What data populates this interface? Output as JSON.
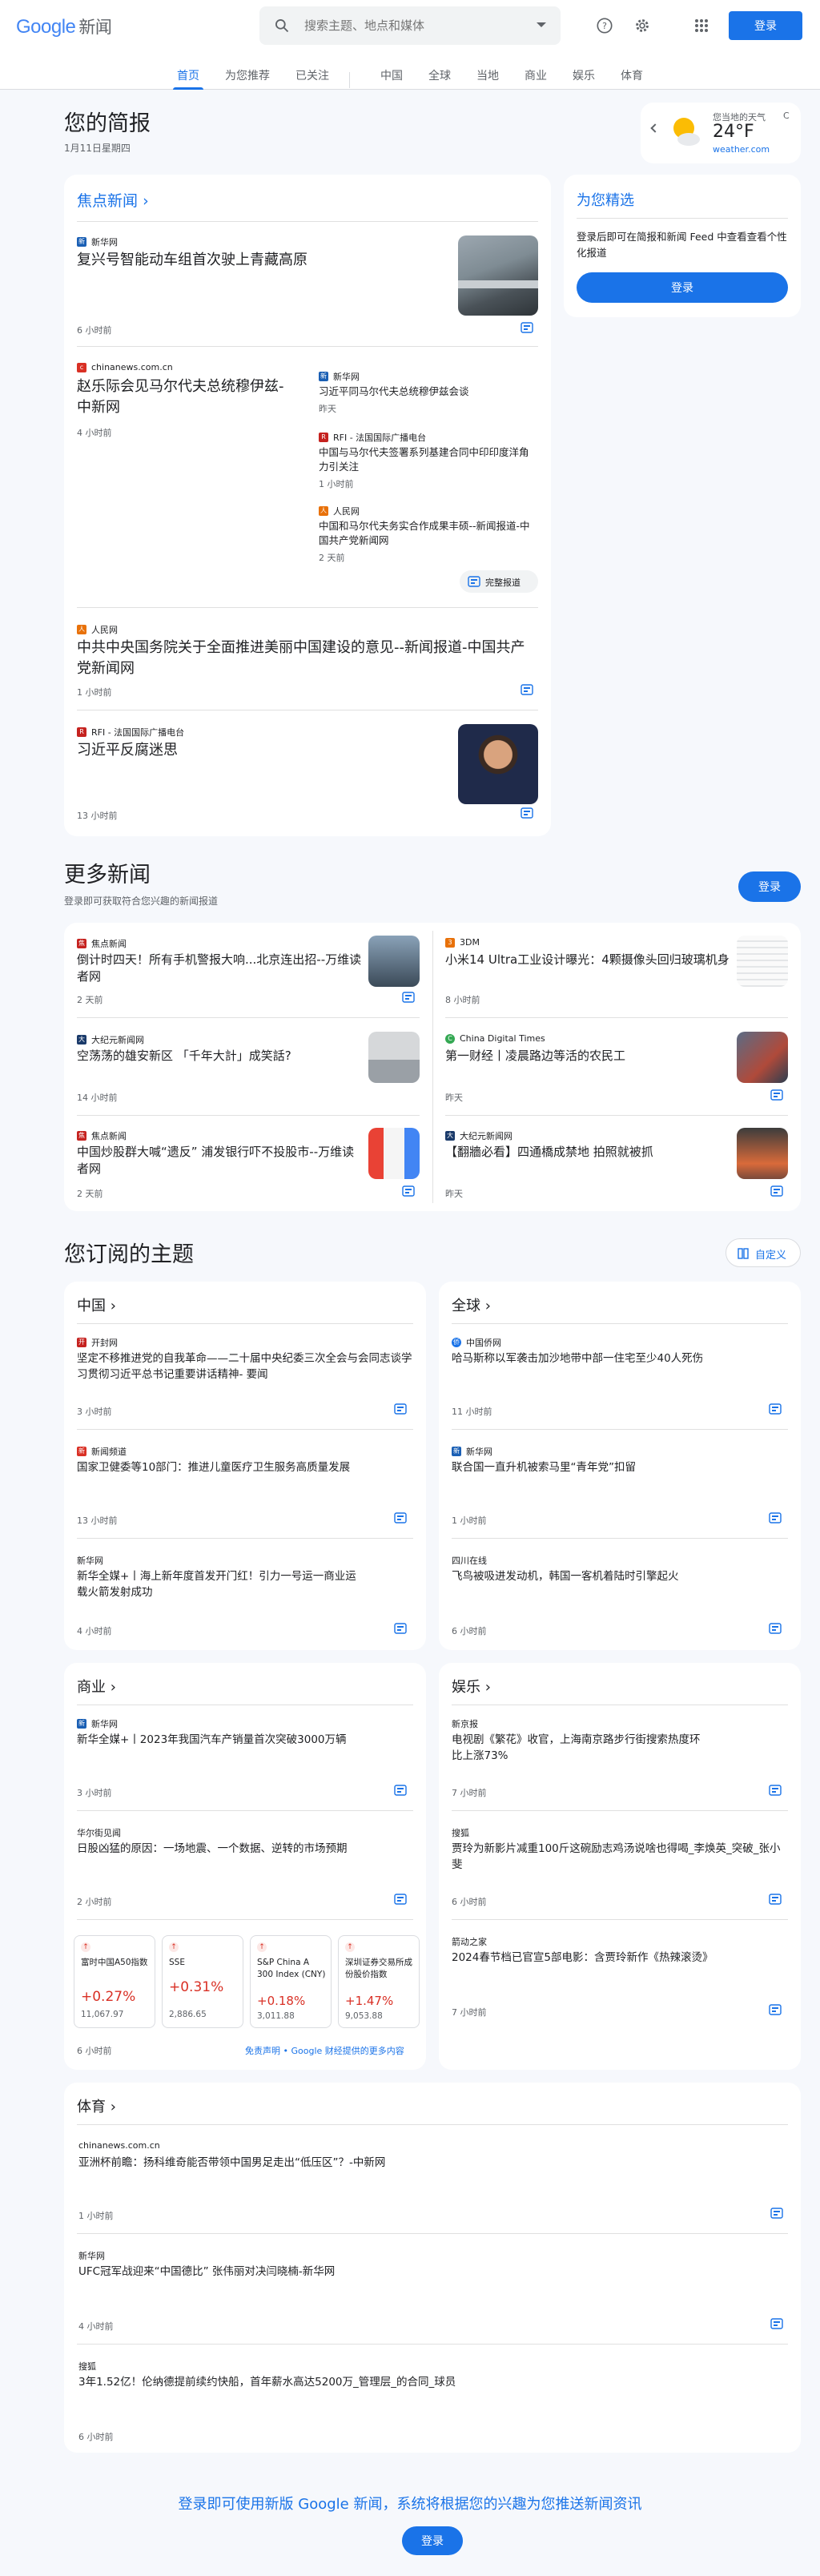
{
  "header": {
    "logo_google": "Google",
    "logo_news": "新闻",
    "search_placeholder": "搜索主题、地点和媒体",
    "signin": "登录"
  },
  "nav": {
    "tabs": [
      "首页",
      "为您推荐",
      "已关注",
      "中国",
      "全球",
      "当地",
      "商业",
      "娱乐",
      "体育"
    ]
  },
  "briefing": {
    "title": "您的简报",
    "date": "1月11日星期四"
  },
  "weather": {
    "label": "您当地的天气",
    "temp": "24°F",
    "unit": "C",
    "source": "weather.com"
  },
  "picks": {
    "title": "为您精选",
    "desc": "登录后即可在简报和新闻 Feed 中查看查看个性化报道",
    "button": "登录"
  },
  "top_stories": {
    "title": "焦点新闻",
    "s1": {
      "source": "新华网",
      "headline": "复兴号智能动车组首次驶上青藏高原",
      "time": "6 小时前"
    },
    "s2": {
      "source": "chinanews.com.cn",
      "headline": "赵乐际会见马尔代夫总统穆伊兹-中新网",
      "time": "4 小时前",
      "related": [
        {
          "source": "新华网",
          "headline": "习近平同马尔代夫总统穆伊兹会谈",
          "time": "昨天"
        },
        {
          "source": "RFI - 法国国际广播电台",
          "headline": "中国与马尔代夫签署系列基建合同中印印度洋角力引关注",
          "time": "1 小时前"
        },
        {
          "source": "人民网",
          "headline": "中国和马尔代夫务实合作成果丰硕--新闻报道-中国共产党新闻网",
          "time": "2 天前"
        }
      ],
      "full_coverage": "完整报道"
    },
    "s3": {
      "source": "人民网",
      "headline": "中共中央国务院关于全面推进美丽中国建设的意见--新闻报道-中国共产党新闻网",
      "time": "1 小时前"
    },
    "s4": {
      "source": "RFI - 法国国际广播电台",
      "headline": "习近平反腐迷思",
      "time": "13 小时前"
    }
  },
  "more": {
    "title": "更多新闻",
    "desc": "登录即可获取符合您兴趣的新闻报道",
    "button": "登录",
    "items": [
      {
        "source": "焦点新闻",
        "headline": "倒计时四天！所有手机警报大响...北京连出招--万维读者网",
        "time": "2 天前"
      },
      {
        "source": "3DM",
        "headline": "小米14 Ultra工业设计曝光：4颗摄像头回归玻璃机身",
        "time": "8 小时前"
      },
      {
        "source": "大纪元新闻网",
        "headline": "空荡荡的雄安新区 「千年大計」成笑話?",
        "time": "14 小时前"
      },
      {
        "source": "China Digital Times",
        "headline": "第一财经丨凌晨路边等活的农民工",
        "time": "昨天"
      },
      {
        "source": "焦点新闻",
        "headline": "中国炒股群大喊“遗反” 浦发银行吓不投股市--万维读者网",
        "time": "2 天前"
      },
      {
        "source": "大纪元新闻网",
        "headline": "【翻牆必看】四通橋成禁地 拍照就被抓",
        "time": "昨天"
      }
    ]
  },
  "topics": {
    "title": "您订阅的主题",
    "customize": "自定义",
    "china": {
      "title": "中国",
      "items": [
        {
          "source": "开封网",
          "headline": "坚定不移推进党的自我革命——二十届中央纪委三次全会与会同志谈学习贯彻习近平总书记重要讲话精神- 要闻",
          "time": "3 小时前"
        },
        {
          "source": "新闻频道",
          "headline": "国家卫健委等10部门：推进儿童医疗卫生服务高质量发展",
          "time": "13 小时前"
        },
        {
          "source": "新华网",
          "headline": "新华全媒+丨海上新年度首发开门红！引力一号运一商业运载火箭发射成功",
          "time": "4 小时前"
        }
      ]
    },
    "world": {
      "title": "全球",
      "items": [
        {
          "source": "中国侨网",
          "headline": "哈马斯称以军袭击加沙地带中部一住宅至少40人死伤",
          "time": "11 小时前"
        },
        {
          "source": "新华网",
          "headline": "联合国一直升机被索马里“青年党”扣留",
          "time": "1 小时前"
        },
        {
          "source": "四川在线",
          "headline": "飞鸟被吸进发动机，韩国一客机着陆时引擎起火",
          "time": "6 小时前"
        }
      ]
    },
    "business": {
      "title": "商业",
      "items": [
        {
          "source": "新华网",
          "headline": "新华全媒+丨2023年我国汽车产销量首次突破3000万辆",
          "time": "3 小时前"
        },
        {
          "source": "华尔街见闻",
          "headline": "日股凶猛的原因：一场地震、一个数据、逆转的市场预期",
          "time": "2 小时前"
        }
      ],
      "stocks": [
        {
          "name": "富时中国A50指数",
          "change": "+0.27%",
          "value": "11,067.97"
        },
        {
          "name": "SSE",
          "change": "+0.31%",
          "value": "2,886.65"
        },
        {
          "name": "S&P China A 300 Index (CNY)",
          "change": "+0.18%",
          "value": "3,011.88"
        },
        {
          "name": "深圳证券交易所成份股价指数",
          "change": "+1.47%",
          "value": "9,053.88"
        }
      ],
      "stock_time": "6 小时前",
      "disclaimer": "免责声明 • Google 财经提供的更多内容"
    },
    "ent": {
      "title": "娱乐",
      "items": [
        {
          "source": "新京报",
          "headline": "电视剧《繁花》收官，上海南京路步行街搜索热度环比上涨73%",
          "time": "7 小时前"
        },
        {
          "source": "搜狐",
          "headline": "贾玲为新影片减重100斤这碗励志鸡汤说啥也得喝_李焕英_突破_张小斐",
          "time": "6 小时前"
        },
        {
          "source": "箭动之家",
          "headline": "2024春节档已官宣5部电影：含贾玲新作《热辣滚烫》",
          "time": "7 小时前"
        }
      ]
    },
    "sports": {
      "title": "体育",
      "items": [
        {
          "source": "chinanews.com.cn",
          "headline": "亚洲杯前瞻：扬科维奇能否带领中国男足走出“低压区”？-中新网",
          "time": "1 小时前"
        },
        {
          "source": "新华网",
          "headline": "UFC冠军战迎来“中国德比” 张伟丽对决闫晓楠-新华网",
          "time": "4 小时前"
        },
        {
          "source": "搜狐",
          "headline": "3年1.52亿！伦纳德提前续约快船，首年薪水高达5200万_管理层_的合同_球员",
          "time": "6 小时前"
        }
      ]
    }
  },
  "footer": {
    "promo": "登录即可使用新版 Google 新闻，系统将根据您的兴趣为您推送新闻资讯",
    "button": "登录"
  }
}
